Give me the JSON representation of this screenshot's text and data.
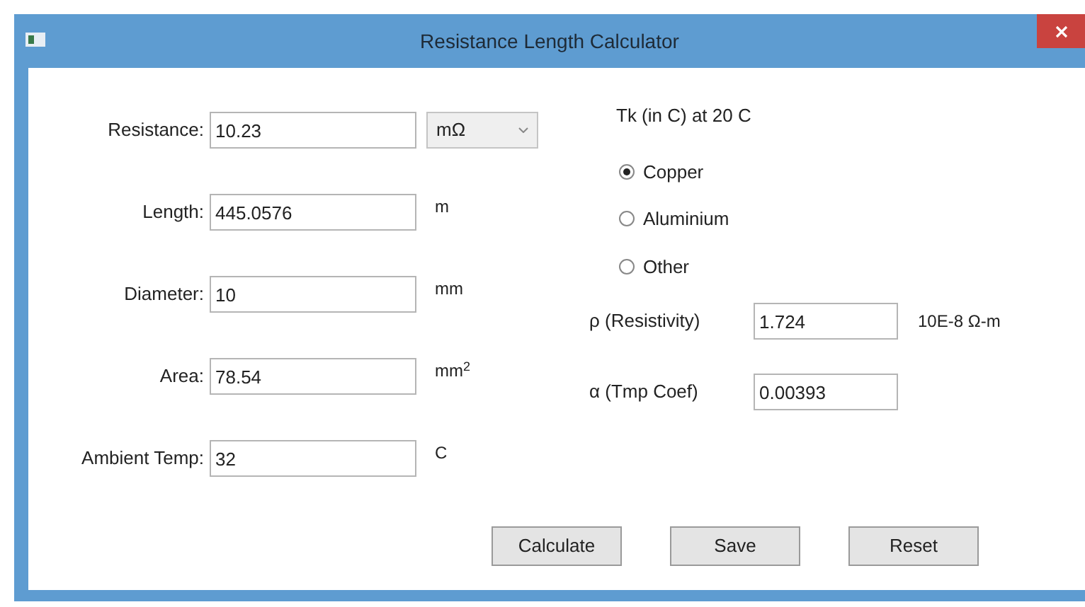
{
  "window": {
    "title": "Resistance Length Calculator"
  },
  "fields": [
    {
      "label": "Resistance:",
      "value": "10.23",
      "unit": "mΩ",
      "kind": "dropdown"
    },
    {
      "label": "Length:",
      "value": "445.0576",
      "unit": "m",
      "kind": "text"
    },
    {
      "label": "Diameter:",
      "value": "10",
      "unit": "mm",
      "kind": "text"
    },
    {
      "label": "Area:",
      "value": "78.54",
      "unit": "mm$^{2}$",
      "kind": "text"
    },
    {
      "label": "Ambient Temp:",
      "value": "32",
      "unit": "C",
      "kind": "text"
    }
  ],
  "material": {
    "heading": "Tk (in C) at 20 C",
    "options": [
      {
        "label": "Copper",
        "selected": true
      },
      {
        "label": "Aluminium",
        "selected": false
      },
      {
        "label": "Other",
        "selected": false
      }
    ]
  },
  "properties": [
    {
      "label": "ρ (Resistivity)",
      "value": "1.724",
      "unit": "10E-8 Ω-m"
    },
    {
      "label": "α (Tmp Coef)",
      "value": "0.00393"
    }
  ],
  "buttons": [
    "Calculate",
    "Save",
    "Reset"
  ]
}
